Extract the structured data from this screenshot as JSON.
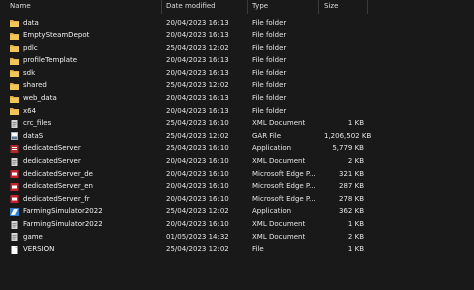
{
  "columns": {
    "name": "Name",
    "date_modified": "Date modified",
    "type": "Type",
    "size": "Size"
  },
  "colors": {
    "background": "#191919",
    "folder": "#e8b84a",
    "text": "#e6e6e6"
  },
  "files": [
    {
      "name": "data",
      "date": "20/04/2023 16:13",
      "type": "File folder",
      "size": "",
      "icon": "folder-icon"
    },
    {
      "name": "EmptySteamDepot",
      "date": "20/04/2023 16:13",
      "type": "File folder",
      "size": "",
      "icon": "folder-icon"
    },
    {
      "name": "pdlc",
      "date": "25/04/2023 12:02",
      "type": "File folder",
      "size": "",
      "icon": "folder-icon"
    },
    {
      "name": "profileTemplate",
      "date": "20/04/2023 16:13",
      "type": "File folder",
      "size": "",
      "icon": "folder-icon"
    },
    {
      "name": "sdk",
      "date": "20/04/2023 16:13",
      "type": "File folder",
      "size": "",
      "icon": "folder-icon"
    },
    {
      "name": "shared",
      "date": "25/04/2023 12:02",
      "type": "File folder",
      "size": "",
      "icon": "folder-icon"
    },
    {
      "name": "web_data",
      "date": "20/04/2023 16:13",
      "type": "File folder",
      "size": "",
      "icon": "folder-icon"
    },
    {
      "name": "x64",
      "date": "20/04/2023 16:13",
      "type": "File folder",
      "size": "",
      "icon": "folder-icon"
    },
    {
      "name": "crc_files",
      "date": "25/04/2023 16:10",
      "type": "XML Document",
      "size": "1 KB",
      "icon": "xml-file-icon"
    },
    {
      "name": "dataS",
      "date": "25/04/2023 12:02",
      "type": "GAR File",
      "size": "1,206,502 KB",
      "icon": "gar-file-icon"
    },
    {
      "name": "dedicatedServer",
      "date": "25/04/2023 16:10",
      "type": "Application",
      "size": "5,779 KB",
      "icon": "server-app-icon"
    },
    {
      "name": "dedicatedServer",
      "date": "20/04/2023 16:10",
      "type": "XML Document",
      "size": "2 KB",
      "icon": "xml-file-icon"
    },
    {
      "name": "dedicatedServer_de",
      "date": "20/04/2023 16:10",
      "type": "Microsoft Edge P...",
      "size": "321 KB",
      "icon": "pdf-file-icon"
    },
    {
      "name": "dedicatedServer_en",
      "date": "20/04/2023 16:10",
      "type": "Microsoft Edge P...",
      "size": "287 KB",
      "icon": "pdf-file-icon"
    },
    {
      "name": "dedicatedServer_fr",
      "date": "20/04/2023 16:10",
      "type": "Microsoft Edge P...",
      "size": "278 KB",
      "icon": "pdf-file-icon"
    },
    {
      "name": "FarmingSimulator2022",
      "date": "25/04/2023 12:02",
      "type": "Application",
      "size": "362 KB",
      "icon": "game-app-icon"
    },
    {
      "name": "FarmingSimulator2022",
      "date": "20/04/2023 16:10",
      "type": "XML Document",
      "size": "1 KB",
      "icon": "xml-file-icon"
    },
    {
      "name": "game",
      "date": "01/05/2023 14:32",
      "type": "XML Document",
      "size": "2 KB",
      "icon": "xml-file-icon"
    },
    {
      "name": "VERSION",
      "date": "25/04/2023 12:02",
      "type": "File",
      "size": "1 KB",
      "icon": "blank-file-icon"
    }
  ]
}
